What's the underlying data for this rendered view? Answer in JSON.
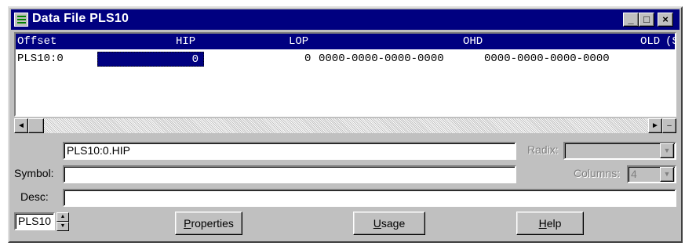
{
  "window": {
    "title": "Data File PLS10",
    "controls": {
      "minimize": "_",
      "maximize": "□",
      "close": "×"
    }
  },
  "grid": {
    "columns": [
      "Offset",
      "HIP",
      "LOP",
      "OHD",
      "OLD",
      "(S"
    ],
    "rows": [
      {
        "offset": "PLS10:0",
        "hip": "0",
        "lop": "0",
        "ohd": "0000-0000-0000-0000",
        "old": "0000-0000-0000-0000"
      }
    ]
  },
  "scrollbar": {
    "left_arrow": "◄",
    "right_arrow": "►",
    "extra": "–"
  },
  "form": {
    "address_value": "PLS10:0.HIP",
    "radix_label": "Radix:",
    "radix_value": "",
    "symbol_label": "Symbol:",
    "symbol_value": "",
    "columns_label": "Columns:",
    "columns_value": "4",
    "desc_label": "Desc:",
    "desc_value": "",
    "file_value": "PLS10"
  },
  "buttons": {
    "properties": {
      "accel": "P",
      "rest": "roperties"
    },
    "usage": {
      "accel": "U",
      "rest": "sage"
    },
    "help": {
      "accel": "H",
      "rest": "elp"
    }
  },
  "icons": [
    "data-file-icon",
    "minimize-icon",
    "maximize-icon",
    "close-icon",
    "left-arrow-icon",
    "right-arrow-icon",
    "dropdown-arrow-icon",
    "spin-up-icon",
    "spin-down-icon"
  ],
  "colors": {
    "titlebar": "#000080",
    "face": "#c0c0c0",
    "selection": "#000080",
    "disabled_text": "#808080"
  }
}
